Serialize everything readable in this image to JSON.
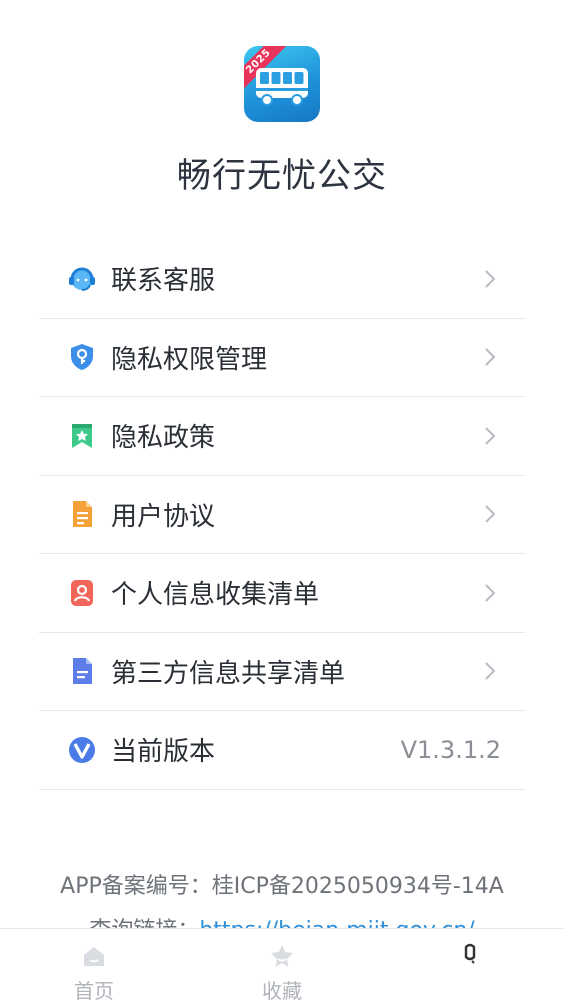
{
  "app": {
    "name": "畅行无忧公交",
    "logo_badge": "2025"
  },
  "menu": {
    "items": [
      {
        "label": "联系客服",
        "icon": "headset-icon"
      },
      {
        "label": "隐私权限管理",
        "icon": "shield-key-icon"
      },
      {
        "label": "隐私政策",
        "icon": "bookmark-star-icon"
      },
      {
        "label": "用户协议",
        "icon": "document-icon"
      },
      {
        "label": "个人信息收集清单",
        "icon": "person-card-icon"
      },
      {
        "label": "第三方信息共享清单",
        "icon": "file-lines-icon"
      },
      {
        "label": "当前版本",
        "icon": "v-logo-icon",
        "value": "V1.3.1.2"
      }
    ]
  },
  "footer": {
    "record_prefix": "APP备案编号：",
    "record_number": "桂ICP备2025050934号-14A",
    "query_prefix": "查询链接：",
    "query_link": "https://beian.miit.gov.cn/"
  },
  "tabbar": {
    "tabs": [
      {
        "label": "首页",
        "icon": "home-icon"
      },
      {
        "label": "收藏",
        "icon": "star-icon"
      },
      {
        "label": "",
        "icon": "profile-icon"
      }
    ]
  },
  "colors": {
    "accent": "#2f8fd8",
    "logo_badge": "#e8335a",
    "text_primary": "#2a2f36",
    "text_secondary": "#8a8f96"
  }
}
